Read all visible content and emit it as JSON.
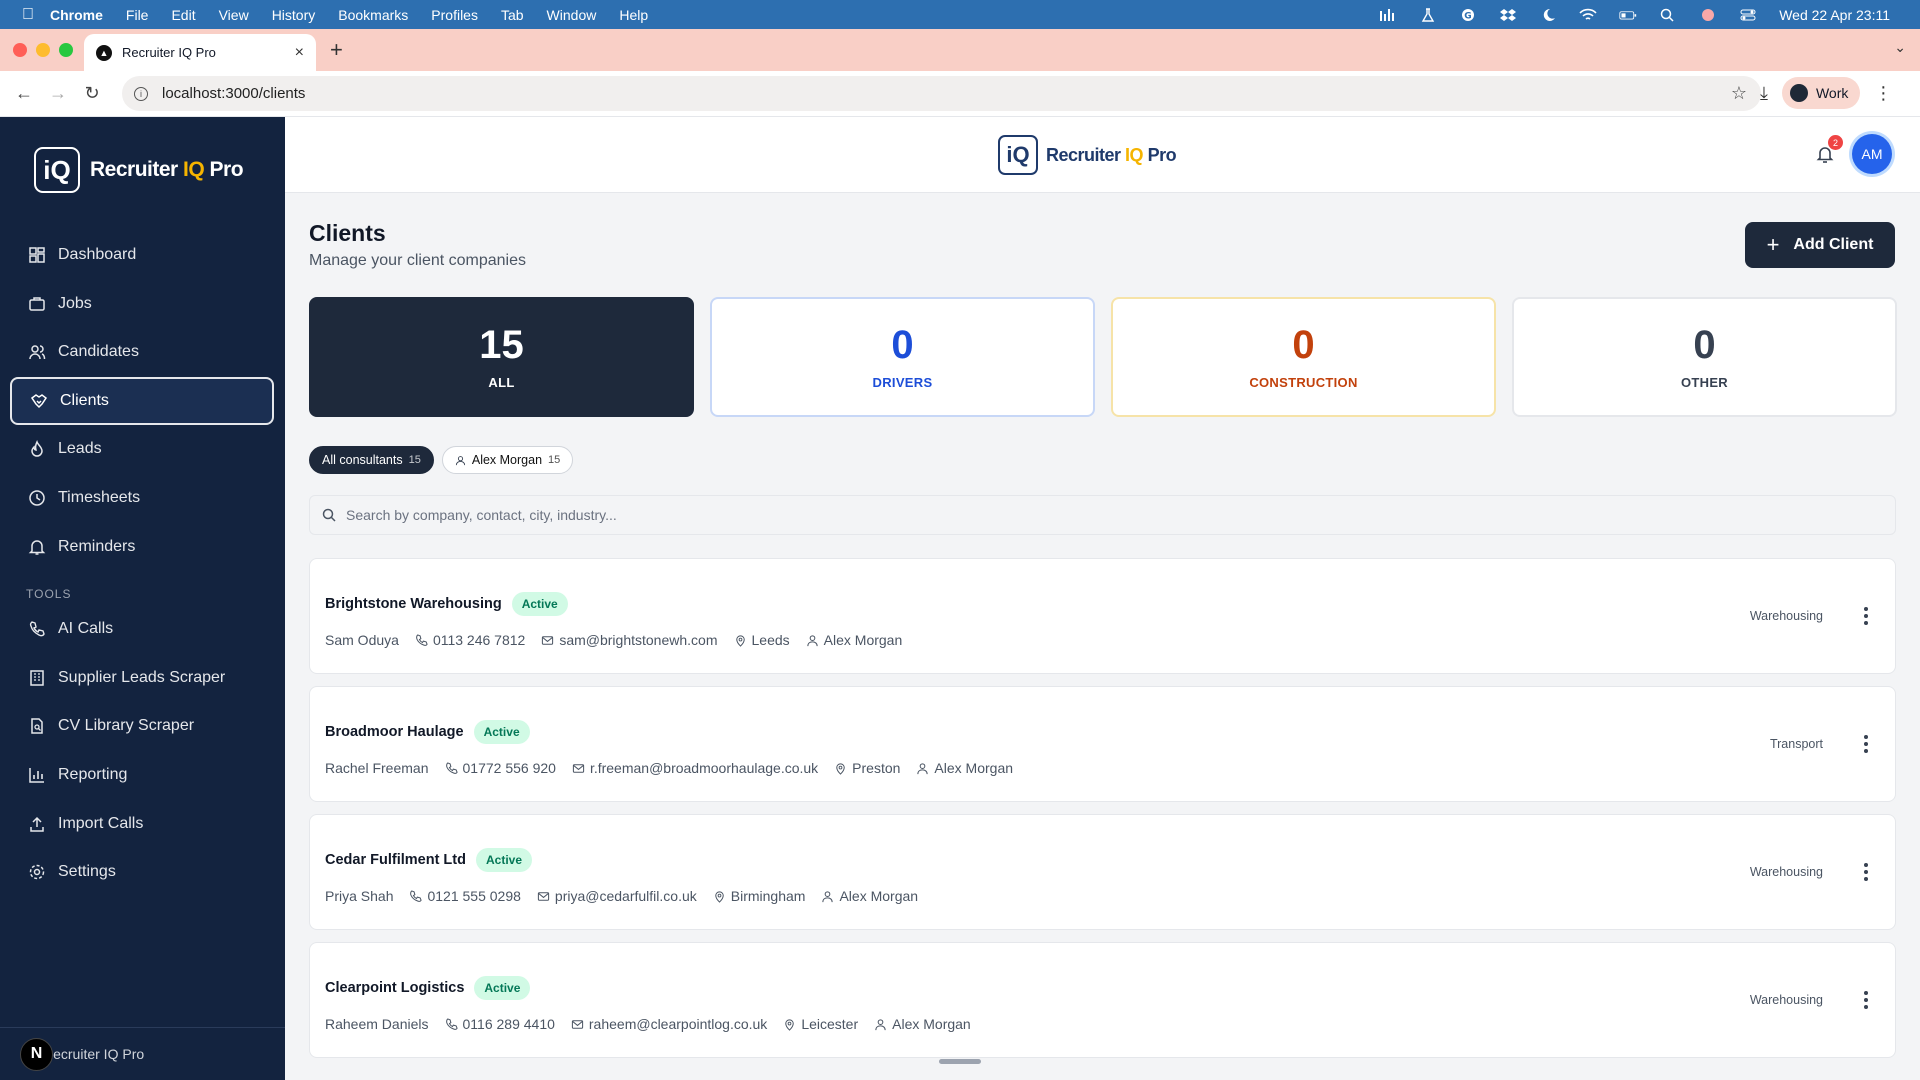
{
  "menubar": {
    "app": "Chrome",
    "menus": [
      "File",
      "Edit",
      "View",
      "History",
      "Bookmarks",
      "Profiles",
      "Tab",
      "Window",
      "Help"
    ],
    "datetime": "Wed 22 Apr  23:11"
  },
  "browser": {
    "tab_title": "Recruiter IQ Pro",
    "url": "localhost:3000/clients",
    "profile": "Work"
  },
  "brand": {
    "mark": "iQ",
    "name_pre": "Recruiter ",
    "name_iq": "IQ",
    "name_post": " Pro"
  },
  "sidebar": {
    "items": [
      {
        "label": "Dashboard"
      },
      {
        "label": "Jobs"
      },
      {
        "label": "Candidates"
      },
      {
        "label": "Clients"
      },
      {
        "label": "Leads"
      },
      {
        "label": "Timesheets"
      },
      {
        "label": "Reminders"
      }
    ],
    "tools_label": "TOOLS",
    "tools": [
      {
        "label": "AI Calls"
      },
      {
        "label": "Supplier Leads Scraper"
      },
      {
        "label": "CV Library Scraper"
      },
      {
        "label": "Reporting"
      },
      {
        "label": "Import Calls"
      },
      {
        "label": "Settings"
      }
    ],
    "footer": "Recruiter IQ Pro",
    "footer_badge": "N"
  },
  "header": {
    "notifications": "2",
    "avatar": "AM"
  },
  "page": {
    "title": "Clients",
    "subtitle": "Manage your client companies",
    "add_button": "Add Client"
  },
  "stats": [
    {
      "value": "15",
      "label": "ALL"
    },
    {
      "value": "0",
      "label": "DRIVERS"
    },
    {
      "value": "0",
      "label": "CONSTRUCTION"
    },
    {
      "value": "0",
      "label": "OTHER"
    }
  ],
  "filters": [
    {
      "label": "All consultants",
      "count": "15"
    },
    {
      "label": "Alex Morgan",
      "count": "15"
    }
  ],
  "search": {
    "placeholder": "Search by company, contact, city, industry..."
  },
  "clients": [
    {
      "company": "Brightstone Warehousing",
      "status": "Active",
      "contact": "Sam Oduya",
      "phone": "0113 246 7812",
      "email": "sam@brightstonewh.com",
      "city": "Leeds",
      "consultant": "Alex Morgan",
      "industry": "Warehousing"
    },
    {
      "company": "Broadmoor Haulage",
      "status": "Active",
      "contact": "Rachel Freeman",
      "phone": "01772 556 920",
      "email": "r.freeman@broadmoorhaulage.co.uk",
      "city": "Preston",
      "consultant": "Alex Morgan",
      "industry": "Transport"
    },
    {
      "company": "Cedar Fulfilment Ltd",
      "status": "Active",
      "contact": "Priya Shah",
      "phone": "0121 555 0298",
      "email": "priya@cedarfulfil.co.uk",
      "city": "Birmingham",
      "consultant": "Alex Morgan",
      "industry": "Warehousing"
    },
    {
      "company": "Clearpoint Logistics",
      "status": "Active",
      "contact": "Raheem Daniels",
      "phone": "0116 289 4410",
      "email": "raheem@clearpointlog.co.uk",
      "city": "Leicester",
      "consultant": "Alex Morgan",
      "industry": "Warehousing"
    }
  ]
}
